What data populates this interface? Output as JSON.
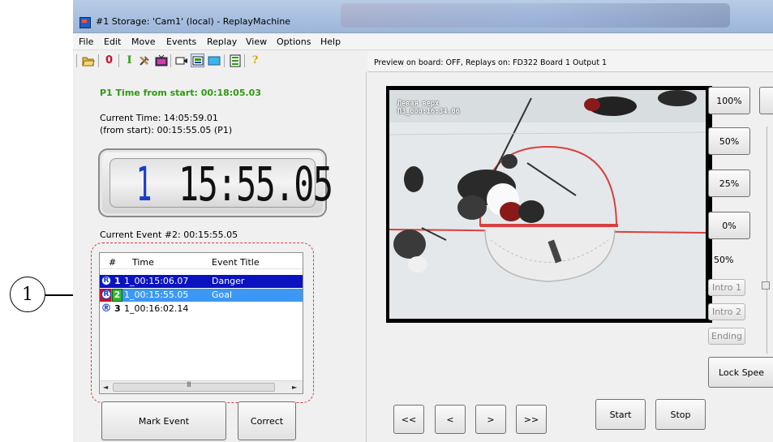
{
  "callout": {
    "label": "1"
  },
  "window": {
    "title": "#1 Storage: 'Cam1' (local) - ReplayMachine"
  },
  "menu": [
    "File",
    "Edit",
    "Move",
    "Events",
    "Replay",
    "View",
    "Options",
    "Help"
  ],
  "toolbar": {
    "icons": [
      "open-folder-icon",
      "zero-icon",
      "marker-icon",
      "tools-icon",
      "tv-icon",
      "camera-icon",
      "film-icon",
      "monitor-icon",
      "list-icon",
      "help-icon"
    ],
    "zero_glyph": "0",
    "marker_glyph": "I",
    "help_glyph": "?"
  },
  "left": {
    "p1_time": "P1 Time from start: 00:18:05.03",
    "current_time": "Current Time: 14:05:59.01",
    "from_start": "(from start): 00:15:55.05 (P1)",
    "lcd_period": "1",
    "lcd_time": "15:55.05",
    "current_event": "Current Event #2: 00:15:55.05"
  },
  "event_list": {
    "headers": {
      "num": "#",
      "time": "Time",
      "title": "Event Title"
    },
    "rows": [
      {
        "badge": "R",
        "num": "1",
        "time": "1_00:15:06.07",
        "title": "Danger"
      },
      {
        "badge": "R",
        "num": "2",
        "time": "1_00:15:55.05",
        "title": "Goal"
      },
      {
        "badge": "®",
        "num": "3",
        "time": "1_00:16:02.14",
        "title": ""
      }
    ],
    "scroll_grip": "III"
  },
  "buttons": {
    "mark_event": "Mark Event",
    "correct": "Correct",
    "p100": "100%",
    "p50": "50%",
    "p25": "25%",
    "p0": "0%",
    "speed": "50%",
    "intro1": "Intro 1",
    "intro2": "Intro 2",
    "ending": "Ending",
    "lock_speed": "Lock Spee",
    "prev_fast": "<<",
    "prev": "<",
    "next": ">",
    "next_fast": ">>",
    "start": "Start",
    "stop": "Stop"
  },
  "preview": {
    "status": "Preview on board: OFF, Replays on: FD322 Board 1 Output 1",
    "overlay_line1": "Левая верх",
    "overlay_line2": "ПЗ_000:16:34.06"
  }
}
